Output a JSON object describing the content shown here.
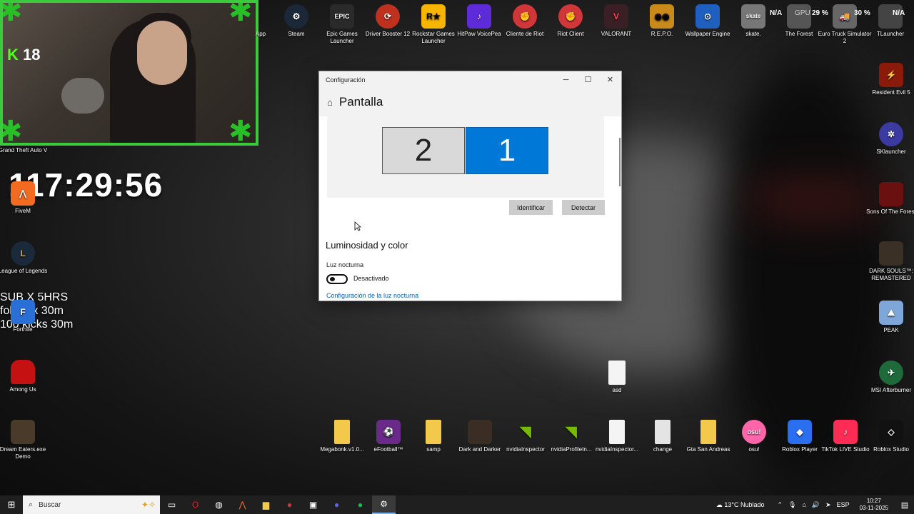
{
  "overlay": {
    "kick_count": "18",
    "kick_letter": "K",
    "timer": "117:29:56",
    "sub_line1": "SUB X 5HRS",
    "sub_line2": "follow x 30m",
    "sub_line3": "100 kicks 30m"
  },
  "desktop_top_icons": [
    {
      "label": "App",
      "icon": "app-icon"
    },
    {
      "label": "Steam",
      "icon": "steam-icon"
    },
    {
      "label": "Epic Games Launcher",
      "icon": "epic-games-icon"
    },
    {
      "label": "Driver Booster 12",
      "icon": "driver-booster-icon"
    },
    {
      "label": "Rockstar Games Launcher",
      "icon": "rockstar-icon"
    },
    {
      "label": "HitPaw VoicePea",
      "icon": "hitpaw-icon"
    },
    {
      "label": "Cliente de Riot",
      "icon": "riot-icon"
    },
    {
      "label": "Riot Client",
      "icon": "riot-icon"
    },
    {
      "label": "VALORANT",
      "icon": "valorant-icon"
    },
    {
      "label": "R.E.P.O.",
      "icon": "repo-icon"
    },
    {
      "label": "Wallpaper Engine",
      "icon": "wallpaper-engine-icon"
    },
    {
      "label": "skate.",
      "icon": "skate-icon"
    },
    {
      "label": "The Forest",
      "icon": "the-forest-icon"
    },
    {
      "label": "Euro Truck Simulator 2",
      "icon": "euro-truck-icon"
    },
    {
      "label": "TLauncher",
      "icon": "tlauncher-icon"
    }
  ],
  "desktop_left_icons": [
    {
      "label": "Grand Theft Auto V"
    },
    {
      "label": "FiveM"
    },
    {
      "label": "League of Legends"
    },
    {
      "label": "Fortnite"
    },
    {
      "label": "Among Us"
    },
    {
      "label": "Dream Eaters.exe Demo"
    }
  ],
  "desktop_right_icons": [
    {
      "label": "Resident Evil 5"
    },
    {
      "label": "SKlauncher"
    },
    {
      "label": "Sons Of The Forest"
    },
    {
      "label": "DARK SOULS™: REMASTERED"
    },
    {
      "label": "PEAK"
    },
    {
      "label": "MSI Afterburner"
    }
  ],
  "desktop_bottom_icons": [
    {
      "label": "Megabonk.v1.0..."
    },
    {
      "label": "eFootball™"
    },
    {
      "label": "samp"
    },
    {
      "label": "Dark and Darker"
    },
    {
      "label": "nvidiaInspector"
    },
    {
      "label": "nvidiaProfileIn..."
    },
    {
      "label": "nvidiaInspector..."
    },
    {
      "label": "change"
    },
    {
      "label": "Gta San Andreas"
    },
    {
      "label": "osu!"
    },
    {
      "label": "Roblox Player"
    },
    {
      "label": "TikTok LIVE Studio"
    },
    {
      "label": "Roblox Studio"
    }
  ],
  "desktop_misc": {
    "asd_label": "asd"
  },
  "hud": {
    "na1": "N/A",
    "gpu_label": "GPU",
    "gpu_value": "29 %",
    "cpu_value": "30 %",
    "na2": "N/A"
  },
  "window": {
    "title": "Configuración",
    "page_title": "Pantalla",
    "monitor2": "2",
    "monitor1": "1",
    "identify_button": "Identificar",
    "detect_button": "Detectar",
    "section_title": "Luminosidad y color",
    "night_light_label": "Luz nocturna",
    "night_light_state": "Desactivado",
    "night_light_link": "Configuración de la luz nocturna"
  },
  "taskbar": {
    "search_placeholder": "Buscar",
    "weather": "13°C  Nublado",
    "language": "ESP",
    "time": "10:27",
    "date": "03-11-2025"
  }
}
